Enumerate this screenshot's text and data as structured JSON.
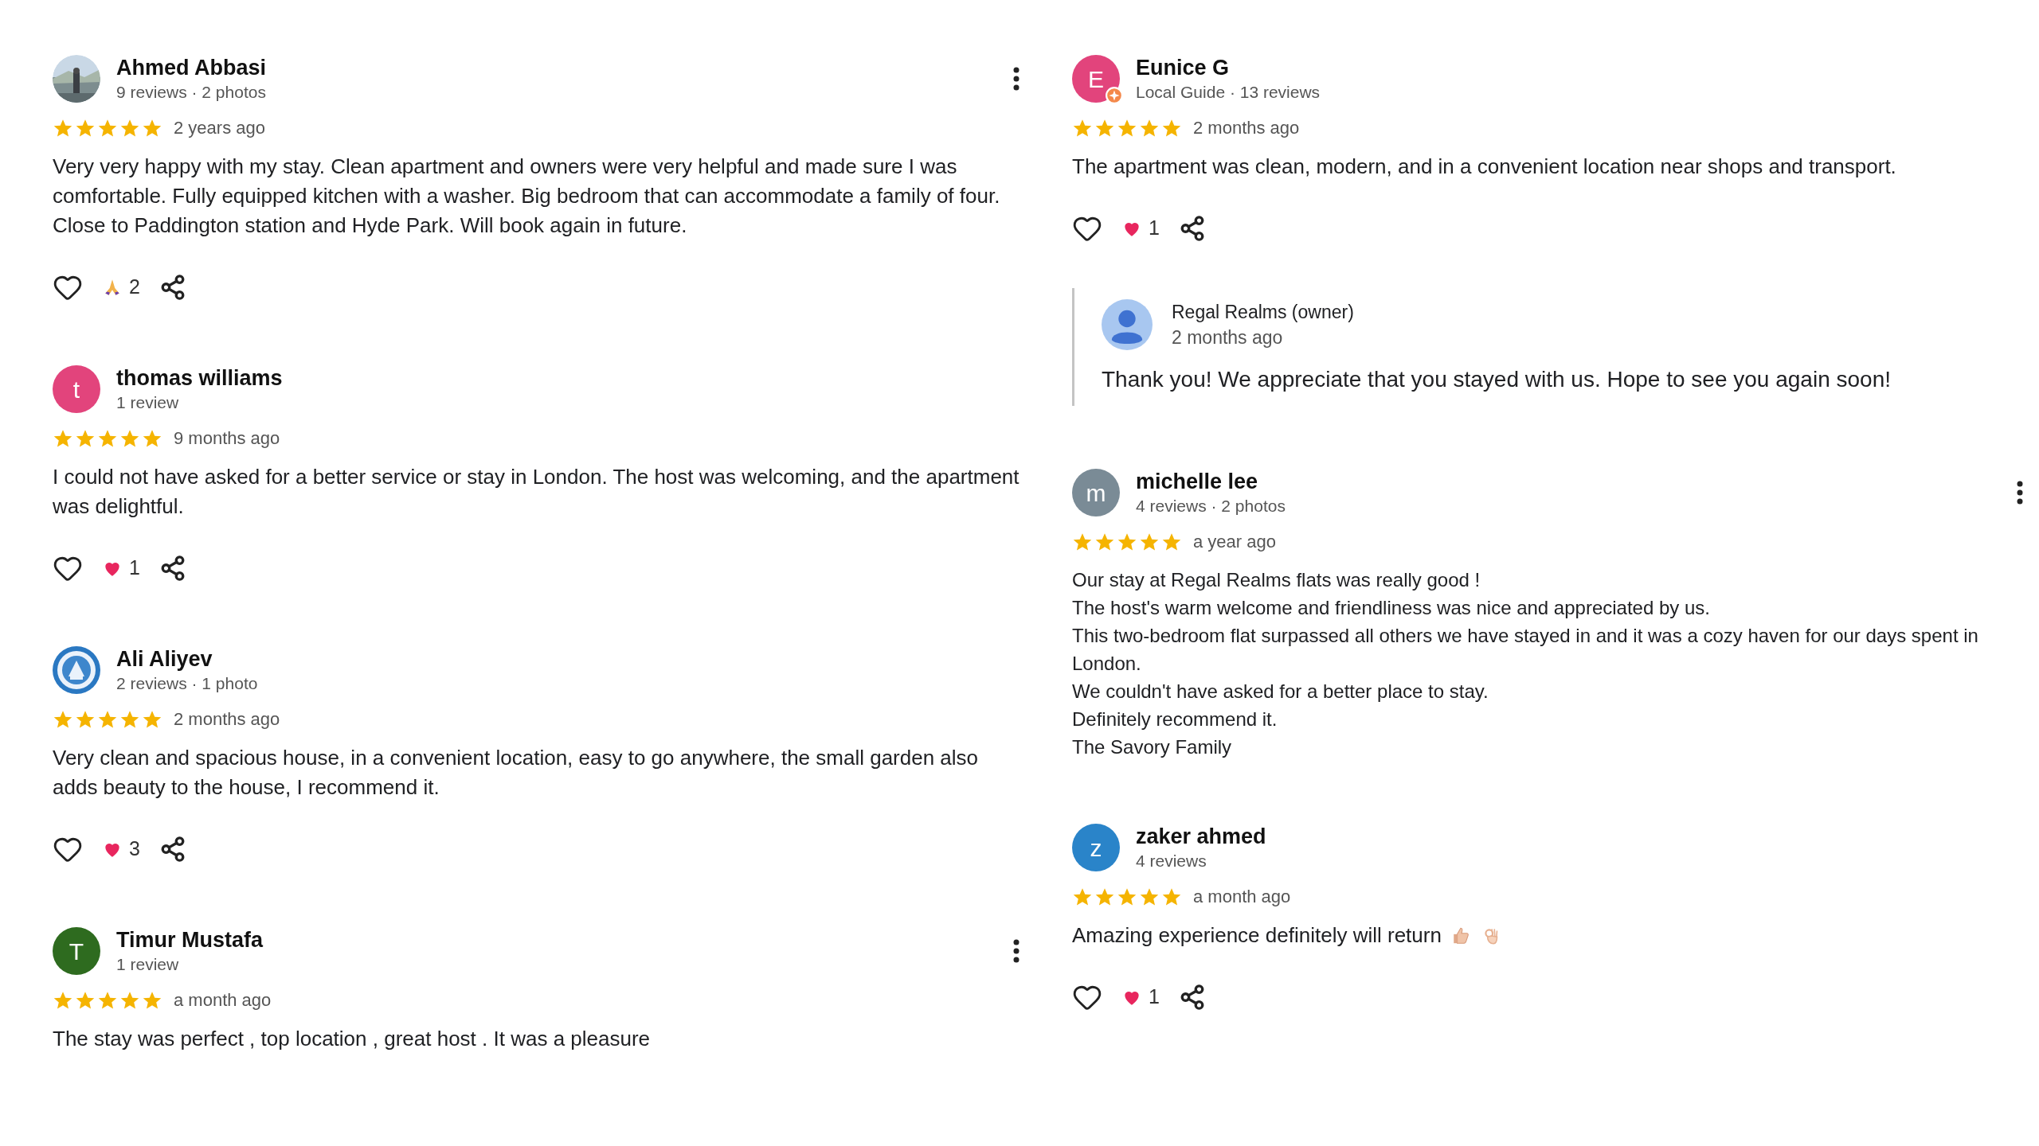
{
  "columns": [
    {
      "reviews": [
        {
          "author": "Ahmed Abbasi",
          "meta": "9 reviews · 2 photos",
          "has_menu": true,
          "stars": 5,
          "time": "2 years ago",
          "text": "Very very happy with my stay. Clean apartment and owners were very helpful and made sure I was comfortable. Fully equipped kitchen with a washer. Big bedroom that can accommodate a family of four. Close to Paddington station and Hyde Park. Will book again in future.",
          "reaction": {
            "kind": "pray",
            "count": "2"
          }
        },
        {
          "author": "thomas williams",
          "meta": "1 review",
          "avatar": {
            "kind": "letter",
            "letter": "t",
            "color": "#e2447c"
          },
          "has_menu": false,
          "stars": 5,
          "time": "9 months ago",
          "text": "I could not have asked for a better service or stay in London. The host was welcoming, and the apartment was delightful.",
          "reaction": {
            "kind": "heart",
            "count": "1"
          }
        },
        {
          "author": "Ali Aliyev",
          "meta": "2 reviews · 1 photo",
          "avatar": {
            "kind": "emblem"
          },
          "has_menu": false,
          "stars": 5,
          "time": "2 months ago",
          "text": "Very clean and spacious house, in a convenient location, easy to go anywhere, the small garden also adds beauty to the house, I recommend it.",
          "reaction": {
            "kind": "heart",
            "count": "3"
          }
        },
        {
          "author": "Timur Mustafa",
          "meta": "1 review",
          "avatar": {
            "kind": "letter",
            "letter": "T",
            "color": "#2e6b1f"
          },
          "has_menu": true,
          "stars": 5,
          "time": "a month ago",
          "text": "The stay was perfect , top location , great host . It was a pleasure"
        }
      ]
    },
    {
      "reviews": [
        {
          "author": "Eunice G",
          "meta": "Local Guide · 13 reviews",
          "avatar": {
            "kind": "letter",
            "letter": "E",
            "color": "#e2447c",
            "guide_badge": true
          },
          "has_menu": false,
          "stars": 5,
          "time": "2 months ago",
          "text": "The apartment was clean, modern, and in a convenient location near shops and transport.",
          "reaction": {
            "kind": "heart",
            "count": "1"
          },
          "reply": {
            "author": "Regal Realms (owner)",
            "time": "2 months ago",
            "text": "Thank you! We appreciate that you stayed with us. Hope to see you again soon!"
          }
        },
        {
          "author": "michelle lee",
          "meta": "4 reviews · 2 photos",
          "avatar": {
            "kind": "letter",
            "letter": "m",
            "color": "#7a8b96"
          },
          "has_menu": true,
          "stars": 5,
          "time": "a year ago",
          "paragraphs": [
            "Our stay at Regal Realms flats was really good !",
            "The host's warm welcome and friendliness was nice and appreciated by us.",
            "This two-bedroom flat surpassed all others we have stayed in and it was a cozy haven for our days spent in London.",
            "We couldn't have asked for a better place to stay.",
            "Definitely recommend it.",
            "The Savory Family"
          ]
        },
        {
          "author": "zaker ahmed",
          "meta": "4 reviews",
          "avatar": {
            "kind": "letter",
            "letter": "z",
            "color": "#2a84c9"
          },
          "has_menu": false,
          "stars": 5,
          "time": "a month ago",
          "text": "Amazing experience definitely will return",
          "trailing_icons": [
            {
              "kind": "thumbs_up"
            },
            {
              "kind": "ok_hand"
            }
          ],
          "reaction": {
            "kind": "heart",
            "count": "1"
          }
        }
      ]
    }
  ]
}
